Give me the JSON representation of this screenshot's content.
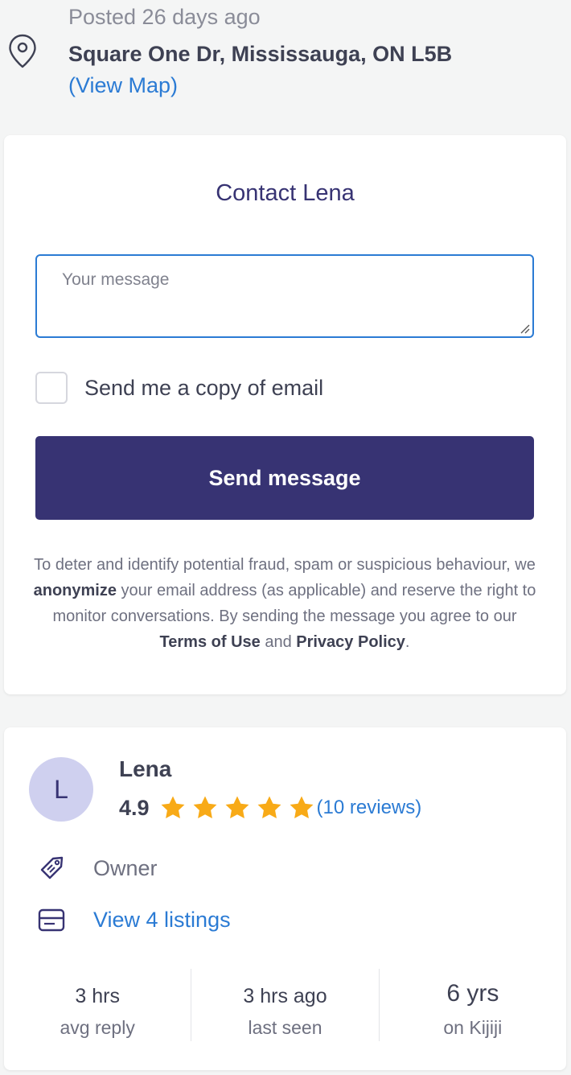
{
  "location": {
    "posted": "Posted 26 days ago",
    "address": "Square One Dr, Mississauga, ON L5B",
    "view_map": "(View Map)",
    "pin_icon": "map-pin-icon"
  },
  "contact": {
    "title": "Contact Lena",
    "message_placeholder": "Your message",
    "message_value": "",
    "copy_label": "Send me a copy of email",
    "copy_checked": false,
    "send_label": "Send message",
    "disclaimer": {
      "part1": "To deter and identify potential fraud, spam or suspicious behaviour, we ",
      "anonymize": "anonymize",
      "part2": " your email address (as applicable) and reserve the right to monitor conversations. By sending the message you agree to our ",
      "terms": "Terms of Use",
      "and": " and ",
      "privacy": "Privacy Policy",
      "end": "."
    }
  },
  "seller": {
    "initial": "L",
    "name": "Lena",
    "rating": "4.9",
    "stars": 5,
    "reviews": "(10 reviews)",
    "owner_label": "Owner",
    "listings_label": "View 4 listings",
    "stats": [
      {
        "value": "3 hrs",
        "label": "avg reply"
      },
      {
        "value": "3 hrs ago",
        "label": "last seen"
      },
      {
        "value": "6 yrs",
        "label": "on Kijiji"
      }
    ]
  },
  "colors": {
    "brand": "#373373",
    "link": "#2b7bd4",
    "star": "#f8aa17",
    "avatar_bg": "#cfd0ef",
    "page_bg": "#f4f5f5"
  }
}
